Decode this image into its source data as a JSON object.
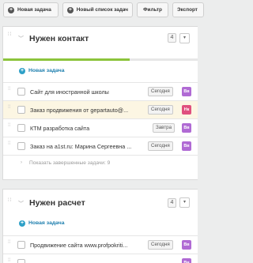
{
  "toolbar": {
    "new_task": "Новая задача",
    "new_list": "Новый список задач",
    "filter": "Фильтр",
    "export": "Экспорт"
  },
  "colors": {
    "progress": "#8cc43c",
    "link": "#1e7fae",
    "avatar_purple": "#b06ad4",
    "avatar_red": "#e0507e",
    "highlight_row": "#fcf6e3"
  },
  "lists": [
    {
      "title": "Нужен контакт",
      "count": "4",
      "progress": 0.65,
      "add_label": "Новая задача",
      "tasks": [
        {
          "text": "Сайт для иностранной школы",
          "date": "Сегодня",
          "avatar": "Вв",
          "avatar_color": "#b06ad4"
        },
        {
          "text": "Заказ продвижения от gepartauto@...",
          "date": "Сегодня",
          "avatar": "Нк",
          "avatar_color": "#e0507e",
          "highlight": true
        },
        {
          "text": "КТМ разработка сайта",
          "date": "Завтра",
          "avatar": "Вв",
          "avatar_color": "#b06ad4"
        },
        {
          "text": "Заказ на a1st.ru: Марина Сергеевна ...",
          "date": "Сегодня",
          "avatar": "Вв",
          "avatar_color": "#b06ad4"
        }
      ],
      "show_done": "Показать завершенные задачи: 9"
    },
    {
      "title": "Нужен расчет",
      "count": "4",
      "progress": 0,
      "add_label": "Новая задача",
      "tasks": [
        {
          "text": "Продвижение сайта www.profpokriti...",
          "date": "Сегодня",
          "avatar": "Вв",
          "avatar_color": "#b06ad4"
        },
        {
          "text": "",
          "date": "",
          "avatar": "Вв",
          "avatar_color": "#b06ad4"
        }
      ]
    }
  ]
}
